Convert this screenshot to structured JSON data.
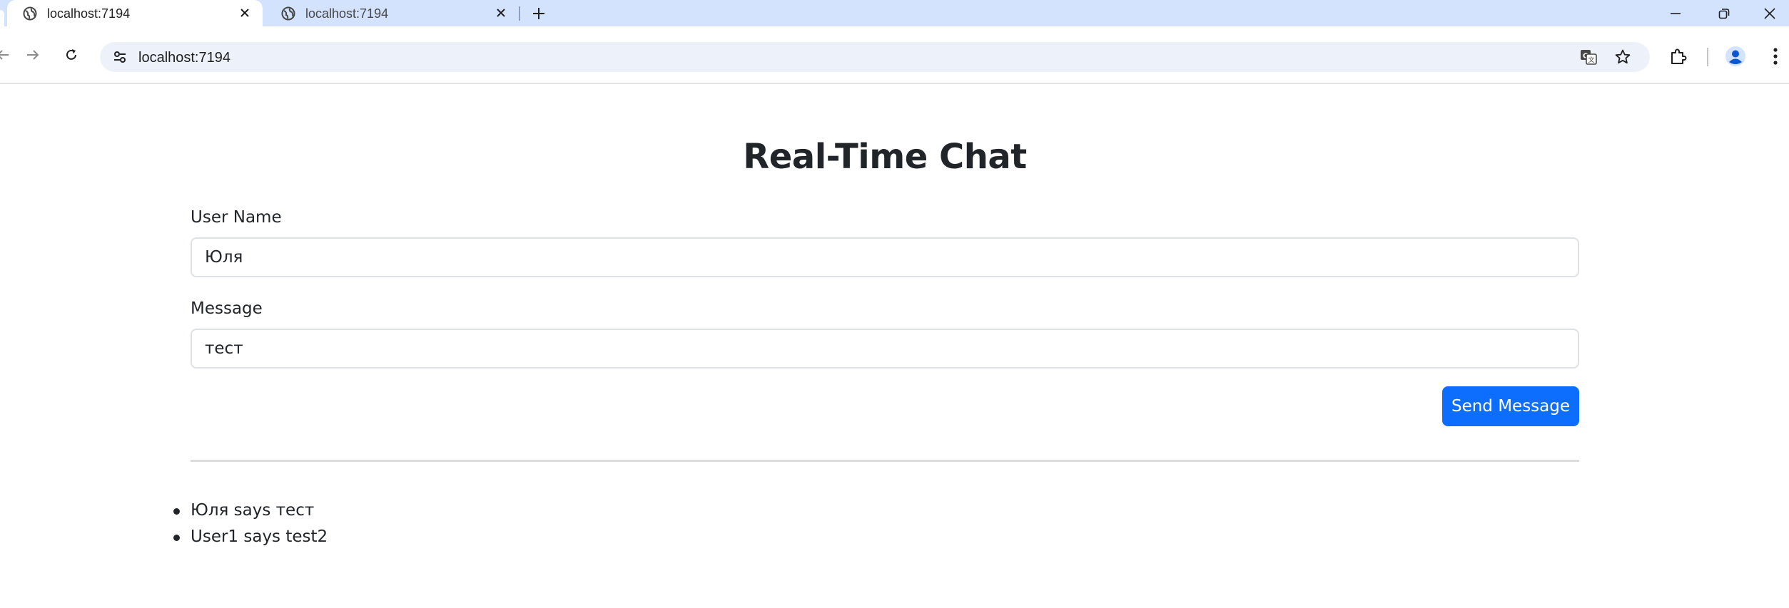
{
  "browser": {
    "tabs": [
      {
        "title": "localhost:7194",
        "active": true
      },
      {
        "title": "localhost:7194",
        "active": false
      }
    ],
    "address_bar": {
      "url": "localhost:7194"
    },
    "icons": {
      "tab_favicon": "globe-icon",
      "back": "arrow-left-icon",
      "forward": "arrow-right-icon",
      "reload": "reload-icon",
      "site_info": "tune-icon",
      "translate": "translate-icon",
      "bookmark": "star-icon",
      "extensions": "puzzle-icon",
      "profile": "person-icon",
      "menu": "kebab-menu-icon"
    },
    "colors": {
      "tabstrip": "#d3e3fd",
      "omnibox": "#edf2fa",
      "profile": "#0b57d0"
    }
  },
  "page": {
    "title": "Real-Time Chat",
    "form": {
      "user_label": "User Name",
      "user_value": "Юля",
      "message_label": "Message",
      "message_value": "тест",
      "send_label": "Send Message"
    },
    "messages": [
      "Юля says тест",
      "User1 says test2"
    ],
    "colors": {
      "primary_button": "#0d6efd",
      "text": "#212529",
      "input_border": "#dee2e6"
    }
  }
}
